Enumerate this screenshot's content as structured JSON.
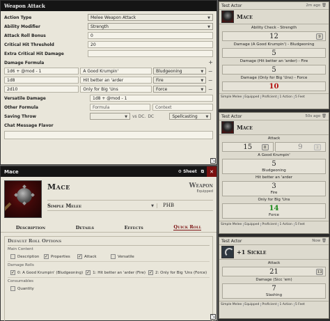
{
  "attack_window": {
    "title": "Weapon Attack",
    "fields": [
      {
        "label": "Action Type",
        "value": "Melee Weapon Attack",
        "kind": "select"
      },
      {
        "label": "Ability Modifier",
        "value": "Strength",
        "kind": "select"
      },
      {
        "label": "Attack Roll Bonus",
        "value": "0",
        "kind": "input"
      },
      {
        "label": "Critical Hit Threshold",
        "value": "20",
        "kind": "input"
      },
      {
        "label": "Extra Critical Hit Damage",
        "value": "",
        "kind": "input"
      }
    ],
    "damage_label": "Damage Formula",
    "damage_rows": [
      {
        "formula": "1d6 + @mod - 1",
        "flavor": "A Good Krumpin'",
        "type": "Bludgeoning"
      },
      {
        "formula": "1d8",
        "flavor": "Hit better an 'arder",
        "type": "Fire"
      },
      {
        "formula": "2d10",
        "flavor": "Only for Big 'Uns",
        "type": "Force"
      }
    ],
    "versatile_label": "Versatile Damage",
    "versatile_value": "1d8 + @mod - 1",
    "other_label": "Other Formula",
    "other_value": "Formula",
    "other_context": "Context",
    "save_label": "Saving Throw",
    "save_vs": "vs DC.",
    "save_dc": "DC",
    "save_scaling": "Spellcasting",
    "flavor_label": "Chat Message Flavor"
  },
  "sheet_window": {
    "title": "Mace",
    "sheet_button": "Sheet",
    "item_name": "Mace",
    "item_type": "Weapon",
    "item_status": "Equipped",
    "item_subtype": "Simple Melee",
    "item_source": "PHB",
    "tabs": [
      "Description",
      "Details",
      "Effects",
      "Quick Roll"
    ],
    "roll_options_title": "Default Roll Options",
    "main_content_label": "Main Content",
    "main_options": [
      {
        "label": "Description",
        "checked": false
      },
      {
        "label": "Properties",
        "checked": true
      },
      {
        "label": "Attack",
        "checked": true
      },
      {
        "label": "Versatile",
        "checked": false
      }
    ],
    "damage_rolls_label": "Damage Rolls",
    "damage_options": [
      {
        "label": "0: A Good Krumpin' (Bludgeoning)",
        "checked": true
      },
      {
        "label": "1: Hit better an 'arder (Fire)",
        "checked": true
      },
      {
        "label": "2: Only for Big 'Uns (Force)",
        "checked": true
      }
    ],
    "consumables_label": "Consumables",
    "consumable_options": [
      {
        "label": "Quantity",
        "checked": false
      }
    ]
  },
  "chat": {
    "messages": [
      {
        "speaker": "Test Actor",
        "time": "2m ago",
        "item": "Mace",
        "rolls": [
          {
            "label": "Ability Check - Strength",
            "value": "12",
            "badge": "9"
          }
        ],
        "damage": [
          {
            "label": "Damage (A Good Krumpin') - Bludgeoning",
            "value": "5",
            "style": "normal"
          },
          {
            "label": "Damage (Hit better an 'arder) - Fire",
            "value": "5",
            "style": "normal"
          },
          {
            "label": "Damage (Only for Big 'Uns) - Force",
            "value": "10",
            "style": "crit"
          }
        ],
        "footer": [
          "Simple Melee",
          "Equipped",
          "Proficient",
          "1 Action",
          "5 Feet"
        ]
      },
      {
        "speaker": "Test Actor",
        "time": "50s ago",
        "item": "Mace",
        "attack_label": "Attack",
        "attack": [
          {
            "value": "15",
            "badge": "8",
            "dim": false
          },
          {
            "value": "9",
            "badge": "2",
            "dim": true
          }
        ],
        "damage": [
          {
            "label": "A Good Krumpin'",
            "value": "5",
            "type": "Bludgeoning",
            "style": "normal"
          },
          {
            "label": "Hit better an 'arder",
            "value": "3",
            "type": "Fire",
            "style": "normal"
          },
          {
            "label": "Only for Big 'Uns",
            "value": "14",
            "type": "Force",
            "style": "green"
          }
        ],
        "footer": [
          "Simple Melee",
          "Equipped",
          "Proficient",
          "1 Action",
          "5 Feet"
        ]
      },
      {
        "speaker": "Test Actor",
        "time": "Now",
        "item": "+1 Sickle",
        "attack_label": "Attack",
        "attack_value": "21",
        "attack_badge": "13",
        "damage_label": "Damage (Sicc 'em)",
        "damage_value": "7",
        "damage_type": "Slashing",
        "footer": [
          "Simple Melee",
          "Equipped",
          "Proficient",
          "1 Action",
          "5 Feet"
        ]
      }
    ]
  },
  "colors": {
    "accent": "#7a1010",
    "crit": "#b41212",
    "success": "#1d8a1d",
    "header": "#151515"
  }
}
